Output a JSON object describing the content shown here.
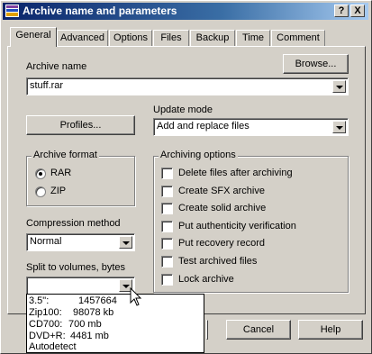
{
  "window": {
    "title": "Archive name and parameters"
  },
  "titlebar_buttons": {
    "help": "?",
    "close": "X"
  },
  "tabs": [
    "General",
    "Advanced",
    "Options",
    "Files",
    "Backup",
    "Time",
    "Comment"
  ],
  "archive_name": {
    "label": "Archive name",
    "browse_label": "Browse...",
    "value": "stuff.rar"
  },
  "profiles_label": "Profiles...",
  "update_mode": {
    "label": "Update mode",
    "value": "Add and replace files"
  },
  "archive_format": {
    "label": "Archive format",
    "options": [
      "RAR",
      "ZIP"
    ],
    "selected": "RAR"
  },
  "compression": {
    "label": "Compression method",
    "value": "Normal"
  },
  "split": {
    "label": "Split to volumes, bytes",
    "value": "",
    "list": [
      {
        "name": "3.5\":",
        "size": "1457664"
      },
      {
        "name": "Zip100:",
        "size": "98078 kb"
      },
      {
        "name": "CD700:",
        "size": "700 mb"
      },
      {
        "name": "DVD+R:",
        "size": "4481 mb"
      },
      {
        "name": "Autodetect",
        "size": ""
      }
    ]
  },
  "archiving_options": {
    "label": "Archiving options",
    "items": [
      {
        "label": "Delete files after archiving",
        "checked": false
      },
      {
        "label": "Create SFX archive",
        "checked": false
      },
      {
        "label": "Create solid archive",
        "checked": false
      },
      {
        "label": "Put authenticity verification",
        "checked": false
      },
      {
        "label": "Put recovery record",
        "checked": false
      },
      {
        "label": "Test archived files",
        "checked": false
      },
      {
        "label": "Lock archive",
        "checked": false
      }
    ]
  },
  "buttons": {
    "cancel": "Cancel",
    "help": "Help"
  }
}
